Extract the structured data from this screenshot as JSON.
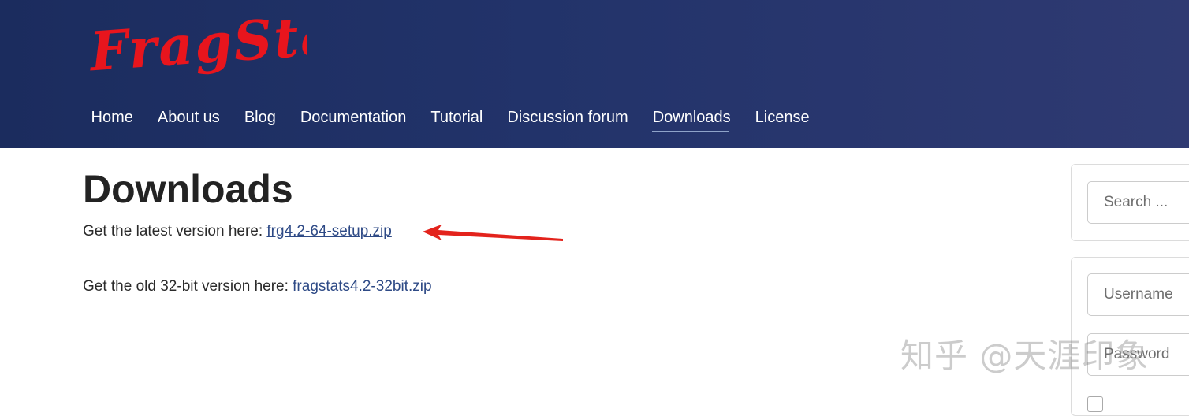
{
  "brand": {
    "logo_text": "FragStats",
    "logo_color": "#e8151d"
  },
  "nav": {
    "items": [
      {
        "label": "Home"
      },
      {
        "label": "About us"
      },
      {
        "label": "Blog"
      },
      {
        "label": "Documentation"
      },
      {
        "label": "Tutorial"
      },
      {
        "label": "Discussion forum"
      },
      {
        "label": "Downloads",
        "active": true
      },
      {
        "label": "License"
      }
    ]
  },
  "main": {
    "title": "Downloads",
    "latest_prefix": "Get the latest version here: ",
    "latest_link": "frg4.2-64-setup.zip",
    "old_prefix": "Get the old 32-bit version here:",
    "old_link": " fragstats4.2-32bit.zip"
  },
  "sidebar": {
    "search_placeholder": "Search ...",
    "username_placeholder": "Username",
    "password_placeholder": "Password"
  },
  "watermark": {
    "text": "知乎 @天涯印象"
  },
  "colors": {
    "header_bg": "#1b2c5e",
    "link": "#2e4a86",
    "arrow": "#e3231c"
  },
  "icons": {
    "annotation": "red-arrow-icon"
  }
}
